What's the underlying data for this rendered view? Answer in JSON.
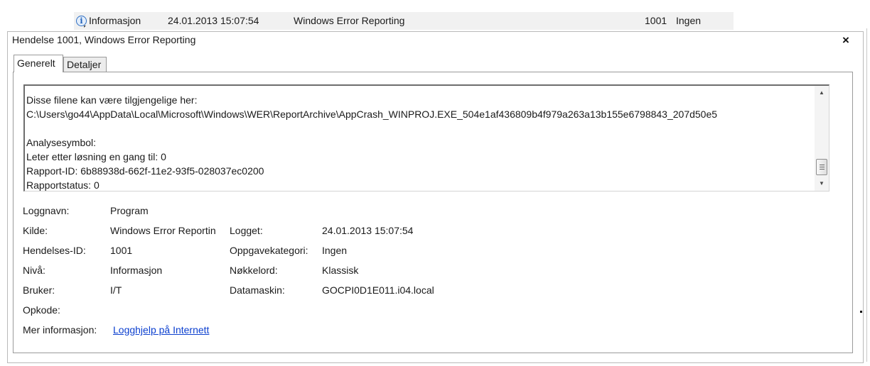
{
  "event_row": {
    "level": "Informasjon",
    "datetime": "24.01.2013 15:07:54",
    "source": "Windows Error Reporting",
    "event_id": "1001",
    "category": "Ingen",
    "icon": "info-icon"
  },
  "panel": {
    "title": "Hendelse 1001, Windows Error Reporting",
    "close_label": "×"
  },
  "tabs": [
    {
      "label": "Generelt",
      "active": true
    },
    {
      "label": "Detaljer",
      "active": false
    }
  ],
  "description": {
    "lines": [
      "Disse filene kan være tilgjengelige her:",
      "C:\\Users\\go44\\AppData\\Local\\Microsoft\\Windows\\WER\\ReportArchive\\AppCrash_WINPROJ.EXE_504e1af436809b4f979a263a13b155e6798843_207d50e5",
      "Analysesymbol:",
      "Leter etter løsning en gang til: 0",
      "Rapport-ID: 6b88938d-662f-11e2-93f5-028037ec0200",
      "Rapportstatus: 0"
    ]
  },
  "properties": {
    "log_name_label": "Loggnavn:",
    "log_name_value": "Program",
    "source_label": "Kilde:",
    "source_value": "Windows Error Reportin",
    "logged_label": "Logget:",
    "logged_value": "24.01.2013 15:07:54",
    "event_id_label": "Hendelses-ID:",
    "event_id_value": "1001",
    "task_category_label": "Oppgavekategori:",
    "task_category_value": "Ingen",
    "level_label": "Nivå:",
    "level_value": "Informasjon",
    "keywords_label": "Nøkkelord:",
    "keywords_value": "Klassisk",
    "user_label": "Bruker:",
    "user_value": "I/T",
    "computer_label": "Datamaskin:",
    "computer_value": "GOCPI0D1E011.i04.local",
    "opcode_label": "Opkode:",
    "more_info_label": "Mer informasjon:",
    "more_info_link": "Logghjelp på Internett"
  }
}
